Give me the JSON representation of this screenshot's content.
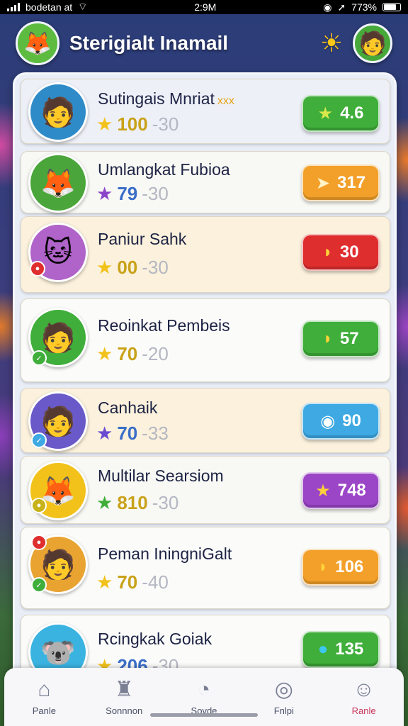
{
  "status": {
    "carrier": "bodetan at",
    "time": "2:9M",
    "battery_pct": "773%"
  },
  "header": {
    "title": "Sterigialt Inamail"
  },
  "players": [
    {
      "name": "Sutingais Mnriat",
      "extra": "xxx",
      "score": "100",
      "range": "-30",
      "pill_value": "4.6",
      "pill_color": "#3fae3a",
      "star_color": "#f2c21b",
      "avatar_bg": "#2f8bc8",
      "avatar_glyph": "🧑",
      "card_bg": "#eef0f8",
      "pill_icon": "★"
    },
    {
      "name": "Umlangkat Fubioa",
      "extra": "",
      "score": "79",
      "range": "-30",
      "pill_value": "317",
      "pill_color": "#f3a02a",
      "star_color": "#8b44c9",
      "avatar_bg": "#4aa63a",
      "avatar_glyph": "🦊",
      "card_bg": "#f8f8f4",
      "pill_icon": "➤"
    },
    {
      "name": "Paniur Sahk",
      "extra": "",
      "score": "00",
      "range": "-30",
      "pill_value": "30",
      "pill_color": "#df2e2e",
      "star_color": "#f2c21b",
      "avatar_bg": "#b063c8",
      "avatar_glyph": "🐱",
      "card_bg": "#fbf1dc",
      "pill_icon": "◗"
    },
    {
      "name": "Reoinkat Pembeis",
      "extra": "",
      "score": "70",
      "range": "-20",
      "pill_value": "57",
      "pill_color": "#3fae3a",
      "star_color": "#f2c21b",
      "avatar_bg": "#3fae3a",
      "avatar_glyph": "🧑",
      "card_bg": "#fbfbfa",
      "pill_icon": "◗"
    },
    {
      "name": "Canhaik",
      "extra": "",
      "score": "70",
      "range": "-33",
      "pill_value": "90",
      "pill_color": "#3ea9e3",
      "star_color": "#6a4ad0",
      "avatar_bg": "#6a59c8",
      "avatar_glyph": "🧑",
      "card_bg": "#fbf1dc",
      "pill_icon": "◉"
    },
    {
      "name": "Multilar Searsiom",
      "extra": "",
      "score": "810",
      "range": "-30",
      "pill_value": "748",
      "pill_color": "#9b45c7",
      "star_color": "#3fae3a",
      "avatar_bg": "#f2c21b",
      "avatar_glyph": "🦊",
      "card_bg": "#f8f8f4",
      "pill_icon": "★"
    },
    {
      "name": "Peman IningniGalt",
      "extra": "",
      "score": "70",
      "range": "-40",
      "pill_value": "106",
      "pill_color": "#f3a02a",
      "star_color": "#f2c21b",
      "avatar_bg": "#e8a331",
      "avatar_glyph": "🧑",
      "card_bg": "#fbfbfa",
      "pill_icon": "◗"
    },
    {
      "name": "Rcingkak Goiak",
      "extra": "",
      "score": "206",
      "range": "-30",
      "pill_value": "135",
      "pill_color": "#3fae3a",
      "star_color": "#f2c21b",
      "avatar_bg": "#3ab3e0",
      "avatar_glyph": "🐨",
      "card_bg": "#fbfbfa",
      "pill_icon": "●"
    }
  ],
  "nav": [
    {
      "label": "Panle",
      "icon": "home-icon",
      "glyph": "⌂"
    },
    {
      "label": "Sonnnon",
      "icon": "trophy-icon",
      "glyph": "♜"
    },
    {
      "label": "Sovde",
      "icon": "chat-icon",
      "glyph": "◔"
    },
    {
      "label": "Fnlpi",
      "icon": "compass-icon",
      "glyph": "◎"
    },
    {
      "label": "Ranle",
      "icon": "profile-icon",
      "glyph": "☺"
    }
  ]
}
